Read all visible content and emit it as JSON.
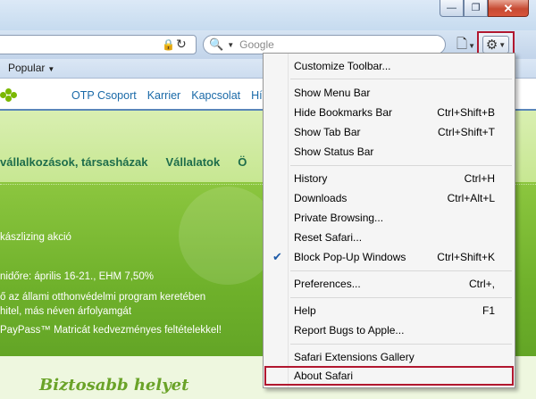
{
  "window": {
    "minimize_glyph": "—",
    "maximize_glyph": "❐",
    "close_glyph": "✕"
  },
  "toolbar": {
    "search_placeholder": "Google"
  },
  "bookmarks": {
    "popular_label": "Popular"
  },
  "page": {
    "top_links": [
      "OTP Csoport",
      "Karrier",
      "Kapcsolat",
      "Hí"
    ],
    "categories": [
      "vállalkozások, társasházak",
      "Vállalatok",
      "Ö"
    ],
    "hero_lines": [
      "kászlizing akció",
      "nidőre: április 16-21., EHM 7,50%",
      "ő az állami otthonvédelmi program keretében",
      "hitel, más néven árfolyamgát",
      "PayPass™ Matricát kedvezményes feltételekkel!"
    ],
    "banner_title": "Biztosabb helyet"
  },
  "menu": {
    "items": [
      {
        "label": "Customize Toolbar...",
        "shortcut": ""
      },
      {
        "label": "Show Menu Bar",
        "shortcut": ""
      },
      {
        "label": "Hide Bookmarks Bar",
        "shortcut": "Ctrl+Shift+B"
      },
      {
        "label": "Show Tab Bar",
        "shortcut": "Ctrl+Shift+T"
      },
      {
        "label": "Show Status Bar",
        "shortcut": ""
      },
      {
        "label": "History",
        "shortcut": "Ctrl+H"
      },
      {
        "label": "Downloads",
        "shortcut": "Ctrl+Alt+L"
      },
      {
        "label": "Private Browsing...",
        "shortcut": ""
      },
      {
        "label": "Reset Safari...",
        "shortcut": ""
      },
      {
        "label": "Block Pop-Up Windows",
        "shortcut": "Ctrl+Shift+K",
        "checked": true,
        "check_glyph": "✔"
      },
      {
        "label": "Preferences...",
        "shortcut": "Ctrl+,"
      },
      {
        "label": "Help",
        "shortcut": "F1"
      },
      {
        "label": "Report Bugs to Apple...",
        "shortcut": ""
      },
      {
        "label": "Safari Extensions Gallery",
        "shortcut": ""
      },
      {
        "label": "About Safari",
        "shortcut": ""
      }
    ]
  },
  "colors": {
    "highlight_border": "#b1172f",
    "page_green": "#7ab800",
    "link_blue": "#1a6aa8"
  }
}
